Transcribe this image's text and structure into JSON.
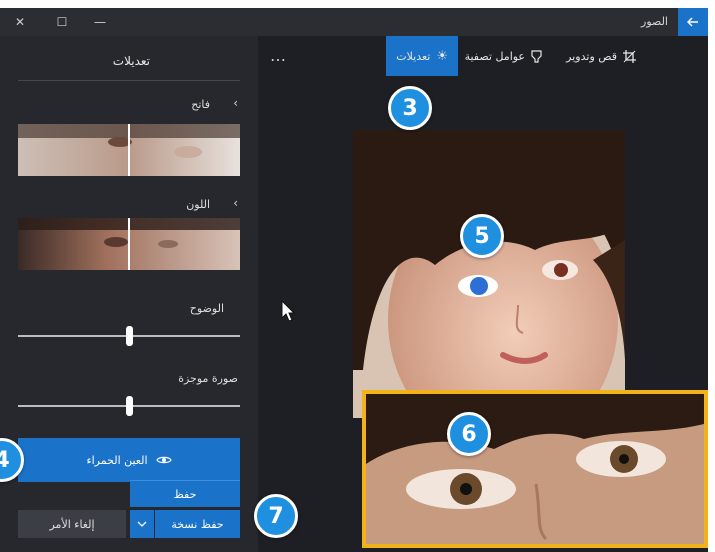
{
  "window": {
    "app_title": "الصور",
    "back_icon": "arrow-left-icon",
    "close_glyph": "✕",
    "maximize_glyph": "☐",
    "minimize_glyph": "—"
  },
  "toolbar": {
    "crop_label": "قص وتدوير",
    "filters_label": "عوامل تصفية",
    "adjust_label": "تعديلات",
    "more_glyph": "…"
  },
  "panel": {
    "title": "تعديلات",
    "light_label": "فاتح",
    "color_label": "اللون",
    "clarity_label": "الوضوح",
    "vignette_label": "صورة موجزة",
    "clarity_value": 0.5,
    "vignette_value": 0.5
  },
  "buttons": {
    "redeye_label": "العين الحمراء",
    "save_label": "حفظ",
    "save_copy_label": "حفظ نسخة",
    "cancel_label": "إلغاء الأمر"
  },
  "callouts": {
    "n3": "3",
    "n4": "4",
    "n5": "5",
    "n6": "6",
    "n7": "7"
  },
  "colors": {
    "accent": "#1a73c9",
    "highlight_frame": "#f2b21a",
    "window_bg": "#1d1f24",
    "panel_bg": "#26282d"
  }
}
